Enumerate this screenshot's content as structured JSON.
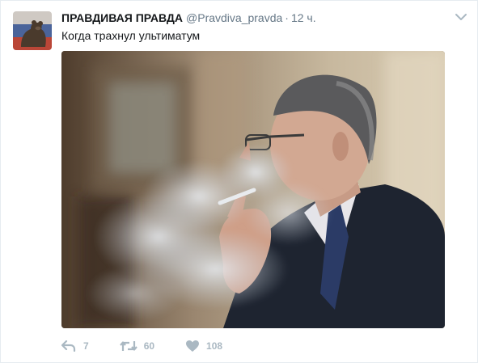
{
  "tweet": {
    "author_name": "ПРАВДИВАЯ ПРАВДА",
    "username": "@Pravdiva_pravda",
    "separator": "·",
    "time": "12 ч.",
    "text": "Когда трахнул ультиматум",
    "actions": {
      "replies": "7",
      "retweets": "60",
      "likes": "108"
    }
  },
  "icons": {
    "caret": "chevron-down-icon",
    "reply": "reply-icon",
    "retweet": "retweet-icon",
    "like": "heart-icon"
  },
  "colors": {
    "text": "#14171a",
    "secondary": "#657786",
    "action_icon": "#aab8c2",
    "border": "#e6ecf0"
  }
}
